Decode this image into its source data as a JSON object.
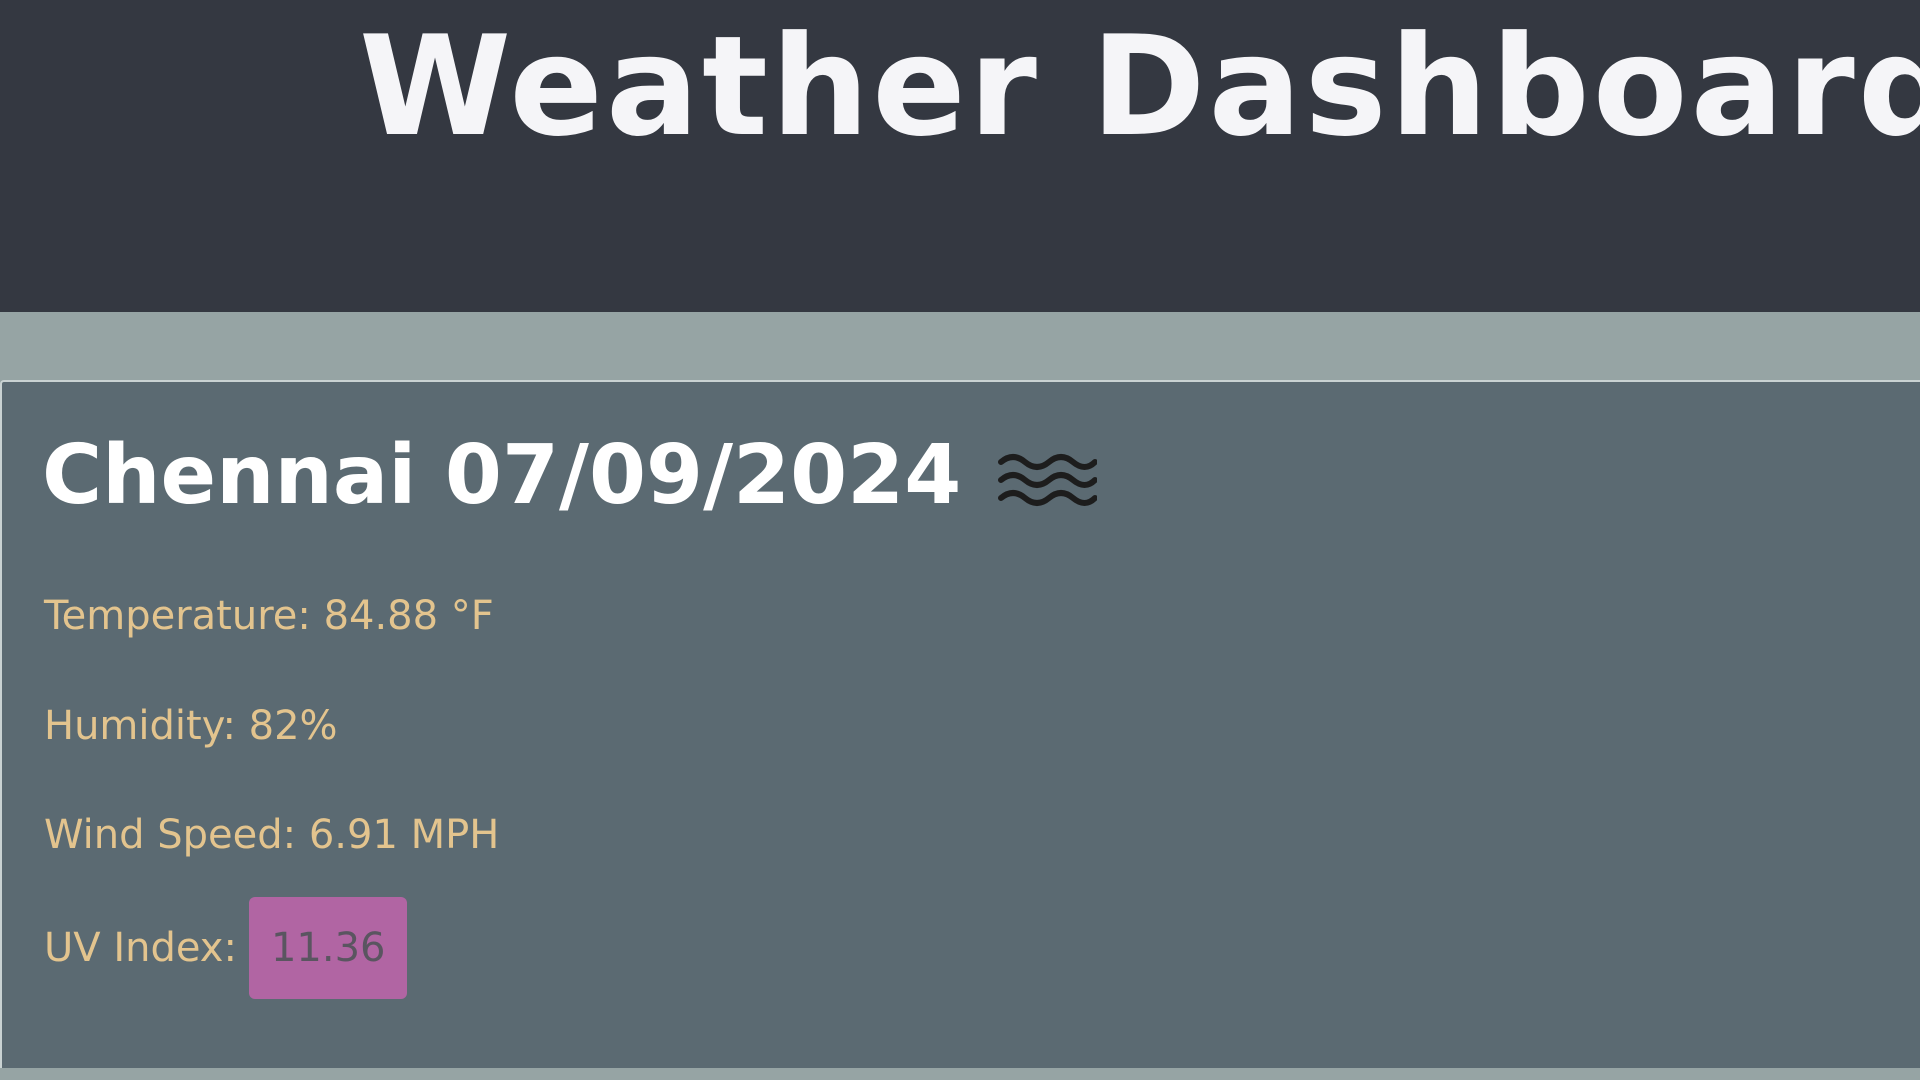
{
  "header": {
    "title": "Weather Dashboard"
  },
  "current": {
    "heading": "Chennai 07/09/2024",
    "icon": "mist-icon",
    "temperature_label": "Temperature: 84.88 °F",
    "humidity_label": "Humidity: 82%",
    "wind_label": "Wind Speed: 6.91 MPH",
    "uv_label": "UV Index:",
    "uv_value": "11.36"
  },
  "colors": {
    "header_bg": "#343841",
    "page_bg": "#96a4a4",
    "card_bg": "#5b6a72",
    "stat_text": "#e3c48e",
    "uv_badge_bg": "#b165a3"
  }
}
